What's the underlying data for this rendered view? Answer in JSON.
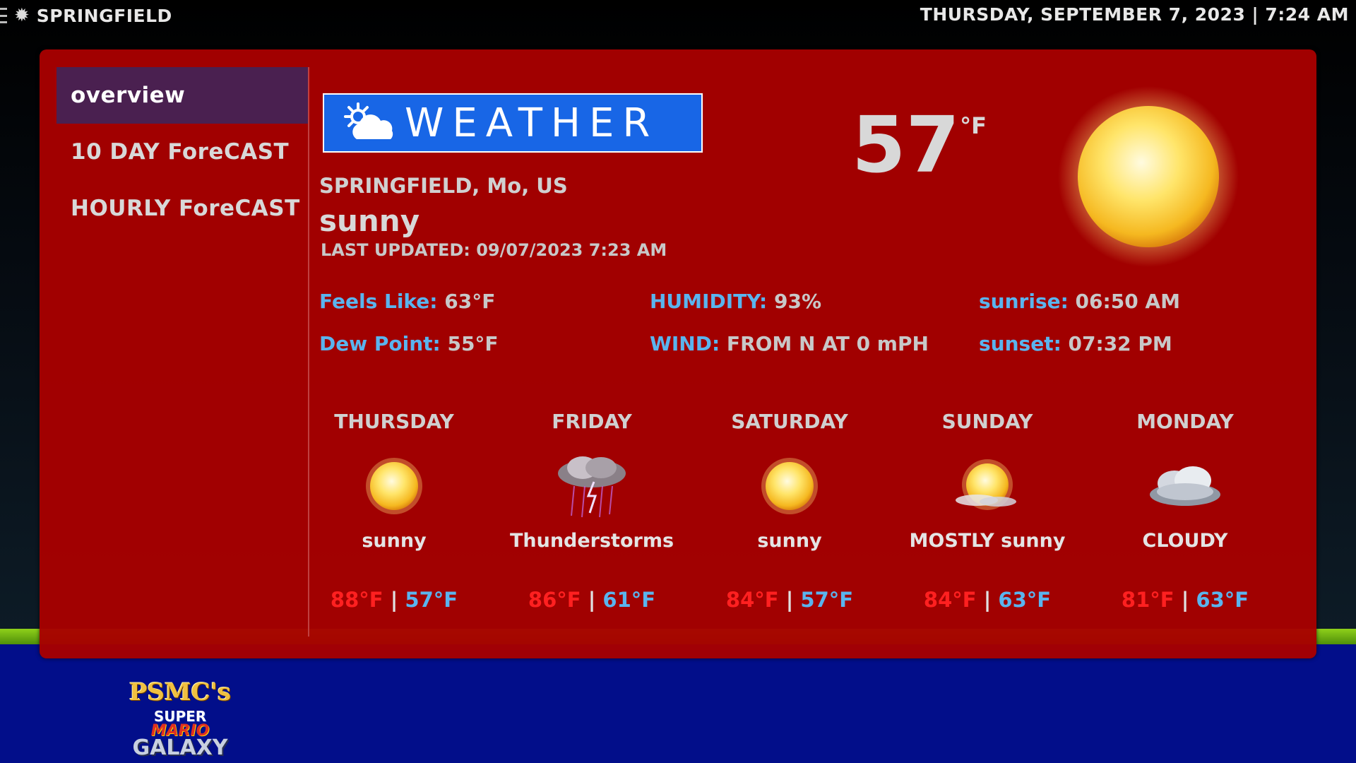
{
  "topbar": {
    "city": "SPRINGFIELD",
    "datetime": "THURSDAY, SEPTEMBER 7, 2023 | 7:24 AM"
  },
  "nav": {
    "items": [
      {
        "label": "overview",
        "active": true
      },
      {
        "label": "10 DAY ForeCAST",
        "active": false
      },
      {
        "label": "HOURLY ForeCAST",
        "active": false
      }
    ]
  },
  "header": {
    "logo_text": "WEATHER",
    "location": "SPRINGFIELD, Mo, US",
    "condition": "sunny",
    "last_updated": "LAST UPDATED: 09/07/2023 7:23 AM",
    "temperature": "57",
    "temperature_unit": "°F"
  },
  "details": {
    "feels_like": {
      "label": "Feels Like:",
      "value": " 63°F"
    },
    "dew_point": {
      "label": "Dew Point:",
      "value": " 55°F"
    },
    "humidity": {
      "label": "HUMIDITY:",
      "value": " 93%"
    },
    "wind": {
      "label": "WIND:",
      "value": " FROM N AT 0 mPH"
    },
    "sunrise": {
      "label": "sunrise:",
      "value": " 06:50 AM"
    },
    "sunset": {
      "label": "sunset:",
      "value": " 07:32 PM"
    }
  },
  "forecast": [
    {
      "day": "THURSDAY",
      "icon": "sun-icon",
      "condition": "sunny",
      "high": "88°F",
      "low": "57°F"
    },
    {
      "day": "FRIDAY",
      "icon": "thunderstorm-icon",
      "condition": "Thunderstorms",
      "high": "86°F",
      "low": "61°F"
    },
    {
      "day": "SATURDAY",
      "icon": "sun-icon",
      "condition": "sunny",
      "high": "84°F",
      "low": "57°F"
    },
    {
      "day": "SUNDAY",
      "icon": "mostly-sunny-icon",
      "condition": "MOSTLY sunny",
      "high": "84°F",
      "low": "63°F"
    },
    {
      "day": "MONDAY",
      "icon": "cloud-icon",
      "condition": "CLOUDY",
      "high": "81°F",
      "low": "63°F"
    }
  ],
  "branding": {
    "line1": "PSMC's",
    "line2": "SUPER",
    "line3": "MARIO",
    "line4": "GALAXY"
  },
  "separator": " | ",
  "colors": {
    "panel": "#a80000",
    "nav_active": "#4a2050",
    "label_blue": "#5ab4ee",
    "high_red": "#ff2020",
    "logo_blue": "#1866e6",
    "bottom_band": "#020e8a",
    "green_band": "#6fb015"
  }
}
